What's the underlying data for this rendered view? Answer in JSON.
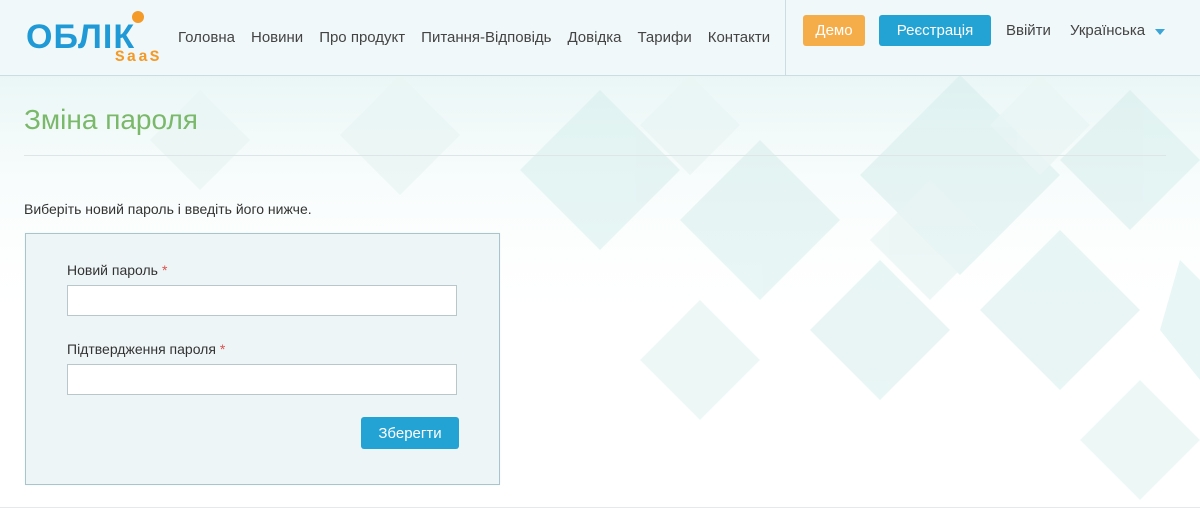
{
  "logo": {
    "main": "ОБЛІК",
    "sub": "SaaS"
  },
  "nav": {
    "items": [
      {
        "label": "Головна"
      },
      {
        "label": "Новини"
      },
      {
        "label": "Про продукт"
      },
      {
        "label": "Питання-Відповідь"
      },
      {
        "label": "Довідка"
      },
      {
        "label": "Тарифи"
      },
      {
        "label": "Контакти"
      }
    ]
  },
  "header": {
    "demo_label": "Демо",
    "register_label": "Реєстрація",
    "login_label": "Ввійти",
    "language": "Українська"
  },
  "page": {
    "title": "Зміна пароля",
    "intro": "Виберіть новий пароль і введіть його нижче."
  },
  "form": {
    "new_password_label": "Новий пароль",
    "new_password_value": "",
    "confirm_label": "Підтвердження пароля",
    "confirm_value": "",
    "required_mark": "*",
    "save_label": "Зберегти"
  },
  "colors": {
    "brand_blue": "#23a3d4",
    "demo_orange": "#f5ad4a",
    "title_green": "#7ab86a",
    "required_red": "#d9534f"
  },
  "icons": {
    "language_caret": "chevron-down-icon"
  }
}
